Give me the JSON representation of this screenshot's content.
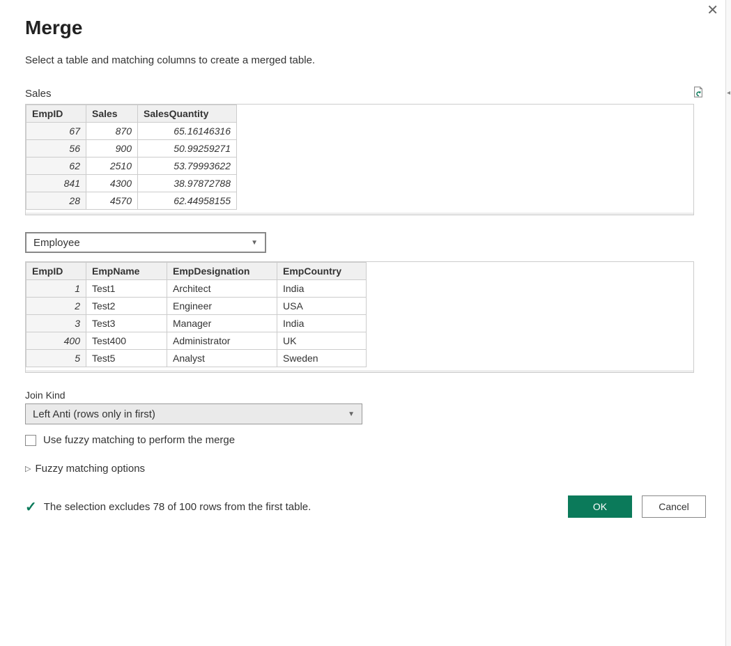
{
  "dialog": {
    "title": "Merge",
    "subtitle": "Select a table and matching columns to create a merged table."
  },
  "table1": {
    "label": "Sales",
    "headers": [
      "EmpID",
      "Sales",
      "SalesQuantity"
    ],
    "rows": [
      [
        "67",
        "870",
        "65.16146316"
      ],
      [
        "56",
        "900",
        "50.99259271"
      ],
      [
        "62",
        "2510",
        "53.79993622"
      ],
      [
        "841",
        "4300",
        "38.97872788"
      ],
      [
        "28",
        "4570",
        "62.44958155"
      ]
    ]
  },
  "table2_selector": {
    "selected": "Employee"
  },
  "table2": {
    "headers": [
      "EmpID",
      "EmpName",
      "EmpDesignation",
      "EmpCountry"
    ],
    "rows": [
      [
        "1",
        "Test1",
        "Architect",
        "India"
      ],
      [
        "2",
        "Test2",
        "Engineer",
        "USA"
      ],
      [
        "3",
        "Test3",
        "Manager",
        "India"
      ],
      [
        "400",
        "Test400",
        "Administrator",
        "UK"
      ],
      [
        "5",
        "Test5",
        "Analyst",
        "Sweden"
      ]
    ]
  },
  "join": {
    "label": "Join Kind",
    "selected": "Left Anti (rows only in first)"
  },
  "fuzzy": {
    "checkbox_label": "Use fuzzy matching to perform the merge",
    "expander_label": "Fuzzy matching options"
  },
  "status": {
    "text": "The selection excludes 78 of 100 rows from the first table."
  },
  "buttons": {
    "ok": "OK",
    "cancel": "Cancel"
  }
}
